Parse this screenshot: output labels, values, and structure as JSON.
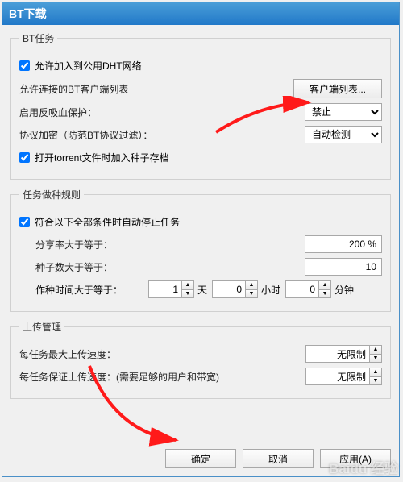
{
  "title": "BT下载",
  "groups": {
    "bt_task": {
      "legend": "BT任务",
      "dht_checkbox": "允许加入到公用DHT网络",
      "client_list_label": "允许连接的BT客户端列表",
      "client_list_button": "客户端列表...",
      "anti_leech_label": "启用反吸血保护：",
      "anti_leech_value": "禁止",
      "encrypt_label": "协议加密（防范BT协议过滤）：",
      "encrypt_value": "自动检测",
      "archive_checkbox": "打开torrent文件时加入种子存档"
    },
    "seed_rule": {
      "legend": "任务做种规则",
      "stop_checkbox": "符合以下全部条件时自动停止任务",
      "share_ratio_label": "分享率大于等于：",
      "share_ratio_value": "200 %",
      "seed_count_label": "种子数大于等于：",
      "seed_count_value": "10",
      "seed_time_label": "作种时间大于等于：",
      "days_value": "1",
      "days_unit": "天",
      "hours_value": "0",
      "hours_unit": "小时",
      "mins_value": "0",
      "mins_unit": "分钟"
    },
    "upload": {
      "legend": "上传管理",
      "max_upload_label": "每任务最大上传速度：",
      "max_upload_value": "无限制",
      "guarantee_label": "每任务保证上传速度：(需要足够的用户和带宽)",
      "guarantee_value": "无限制"
    }
  },
  "buttons": {
    "ok": "确定",
    "cancel": "取消",
    "apply": "应用(A)"
  },
  "watermark": "Baidu 经验"
}
